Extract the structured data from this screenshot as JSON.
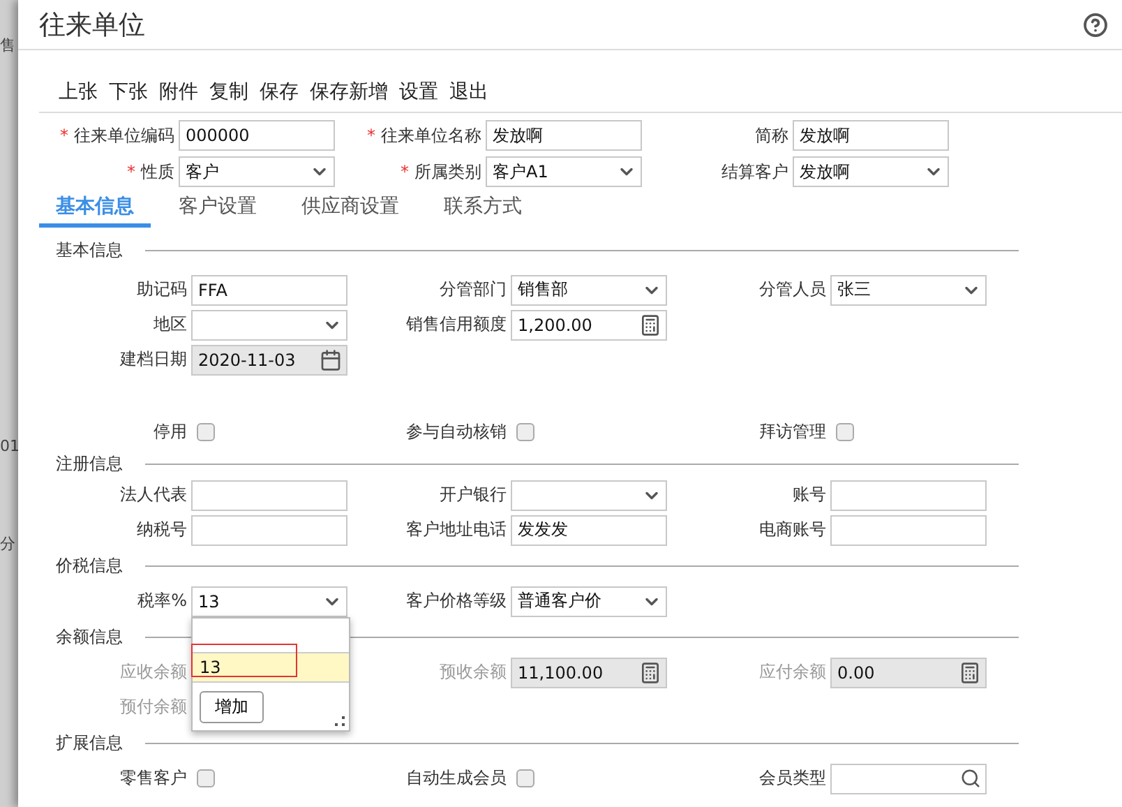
{
  "backdrop": [
    "售",
    "01",
    "分"
  ],
  "window": {
    "title": "往来单位"
  },
  "toolbar": [
    "上张",
    "下张",
    "附件",
    "复制",
    "保存",
    "保存新增",
    "设置",
    "退出"
  ],
  "header_rows": [
    [
      {
        "kind": "text",
        "required_mark": "*",
        "label": "往来单位编码",
        "value": "000000"
      },
      {
        "kind": "text",
        "required_mark": "*",
        "label": "往来单位名称",
        "value": "发放啊"
      },
      {
        "kind": "text",
        "label": "简称",
        "value": "发放啊"
      }
    ],
    [
      {
        "kind": "select",
        "required_mark": "*",
        "label": "性质",
        "value": "客户"
      },
      {
        "kind": "select",
        "required_mark": "*",
        "label": "所属类别",
        "value": "客户A1"
      },
      {
        "kind": "select",
        "label": "结算客户",
        "value": "发放啊"
      }
    ]
  ],
  "tabs": [
    {
      "label": "基本信息",
      "selected": true
    },
    {
      "label": "客户设置",
      "selected": false
    },
    {
      "label": "供应商设置",
      "selected": false
    },
    {
      "label": "联系方式",
      "selected": false
    }
  ],
  "sections": [
    {
      "title": "基本信息",
      "rows": [
        [
          {
            "kind": "text",
            "label": "助记码",
            "value": "FFA"
          },
          {
            "kind": "select",
            "label": "分管部门",
            "value": "销售部"
          },
          {
            "kind": "select",
            "label": "分管人员",
            "value": "张三"
          }
        ],
        [
          {
            "kind": "select",
            "label": "地区"
          },
          {
            "kind": "money",
            "label": "销售信用额度",
            "value": "1,200.00"
          },
          null
        ],
        [
          {
            "kind": "date",
            "label": "建档日期",
            "value": "2020-11-03",
            "disabled": true
          },
          null,
          null
        ],
        [
          {
            "kind": "spacer"
          }
        ],
        [
          {
            "kind": "checkbox",
            "label": "停用",
            "checked": false
          },
          {
            "kind": "checkbox",
            "label": "参与自动核销",
            "checked": false
          },
          {
            "kind": "checkbox",
            "label": "拜访管理",
            "checked": false
          }
        ]
      ]
    },
    {
      "title": "注册信息",
      "rows": [
        [
          {
            "kind": "text",
            "label": "法人代表"
          },
          {
            "kind": "select",
            "label": "开户银行"
          },
          {
            "kind": "text",
            "label": "账号"
          }
        ],
        [
          {
            "kind": "text",
            "label": "纳税号"
          },
          {
            "kind": "text",
            "label": "客户地址电话",
            "value": "发发发"
          },
          {
            "kind": "text",
            "label": "电商账号"
          }
        ]
      ]
    },
    {
      "title": "价税信息",
      "rows": [
        [
          {
            "kind": "select",
            "label": "税率%",
            "value": "13",
            "open": true
          },
          {
            "kind": "select",
            "label": "客户价格等级",
            "value": "普通客户价"
          },
          null
        ]
      ]
    },
    {
      "title": "余额信息",
      "rows": [
        [
          {
            "kind": "covered",
            "label": "应收余额",
            "greyed_label": true
          },
          {
            "kind": "money",
            "label": "预收余额",
            "value": "11,100.00",
            "disabled": true,
            "greyed_label": true
          },
          {
            "kind": "money",
            "label": "应付余额",
            "value": "0.00",
            "disabled": true,
            "greyed_label": true
          }
        ],
        [
          {
            "kind": "covered",
            "label": "预付余额",
            "greyed_label": true
          },
          null,
          null
        ]
      ]
    },
    {
      "title": "扩展信息",
      "rows": [
        [
          {
            "kind": "checkbox",
            "label": "零售客户",
            "checked": false
          },
          {
            "kind": "checkbox",
            "label": "自动生成会员",
            "checked": false
          },
          {
            "kind": "lookup",
            "label": "会员类型"
          }
        ]
      ]
    }
  ],
  "dropdown": {
    "options": [
      {
        "kind": "blank",
        "selected": false
      },
      {
        "kind": "option",
        "label": "13",
        "selected": true
      }
    ],
    "button": "增加"
  }
}
